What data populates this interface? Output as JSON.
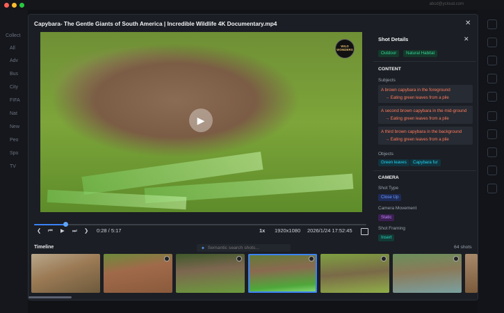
{
  "window": {
    "dots": [
      "#ff5f57",
      "#febc2e",
      "#28c840"
    ]
  },
  "background": {
    "user_email": "abcd@ycloud.com",
    "sidebar_items": [
      "All",
      "Adv",
      "Bus",
      "City",
      "FIFA",
      "Nat",
      "New",
      "Peo",
      "Spo",
      "TV"
    ],
    "section_label": "Collect"
  },
  "modal": {
    "title": "Capybara- The Gentle Giants of South America | Incredible Wildlife 4K Documentary.mp4",
    "close": "✕"
  },
  "player": {
    "logo_text": "WILD WONDERS",
    "progress_fraction": 0.094,
    "time": "0:28 / 5:17",
    "speed": "1x",
    "resolution": "1920x1080",
    "date": "2026/1/24 17:52:45",
    "icons": [
      "chevron-left-icon",
      "skip-back-icon",
      "play-icon",
      "skip-forward-icon",
      "chevron-right-icon",
      "panel-toggle-icon"
    ]
  },
  "timeline": {
    "label": "Timeline",
    "search_placeholder": "Semantic search shots...",
    "shot_count": "64 shots",
    "selected_index": 3
  },
  "details": {
    "title": "Shot Details",
    "tags": [
      "Outdoor",
      "Natural Habitat"
    ],
    "content_heading": "CONTENT",
    "subjects_label": "Subjects",
    "subjects": [
      {
        "name": "A brown capybara in the foreground",
        "action": "→ Eating green leaves from a pile"
      },
      {
        "name": "A second brown capybara in the mid-ground",
        "action": "→ Eating green leaves from a pile"
      },
      {
        "name": "A third brown capybara in the background",
        "action": "→ Eating green leaves from a pile"
      }
    ],
    "objects_label": "Objects",
    "objects": [
      "Green leaves",
      "Capybara fur"
    ],
    "camera_heading": "CAMERA",
    "shot_type_label": "Shot Type",
    "shot_type": "Close Up",
    "movement_label": "Camera Movement",
    "movement": "Static",
    "framing_label": "Shot Framing",
    "framing": "Insert"
  }
}
